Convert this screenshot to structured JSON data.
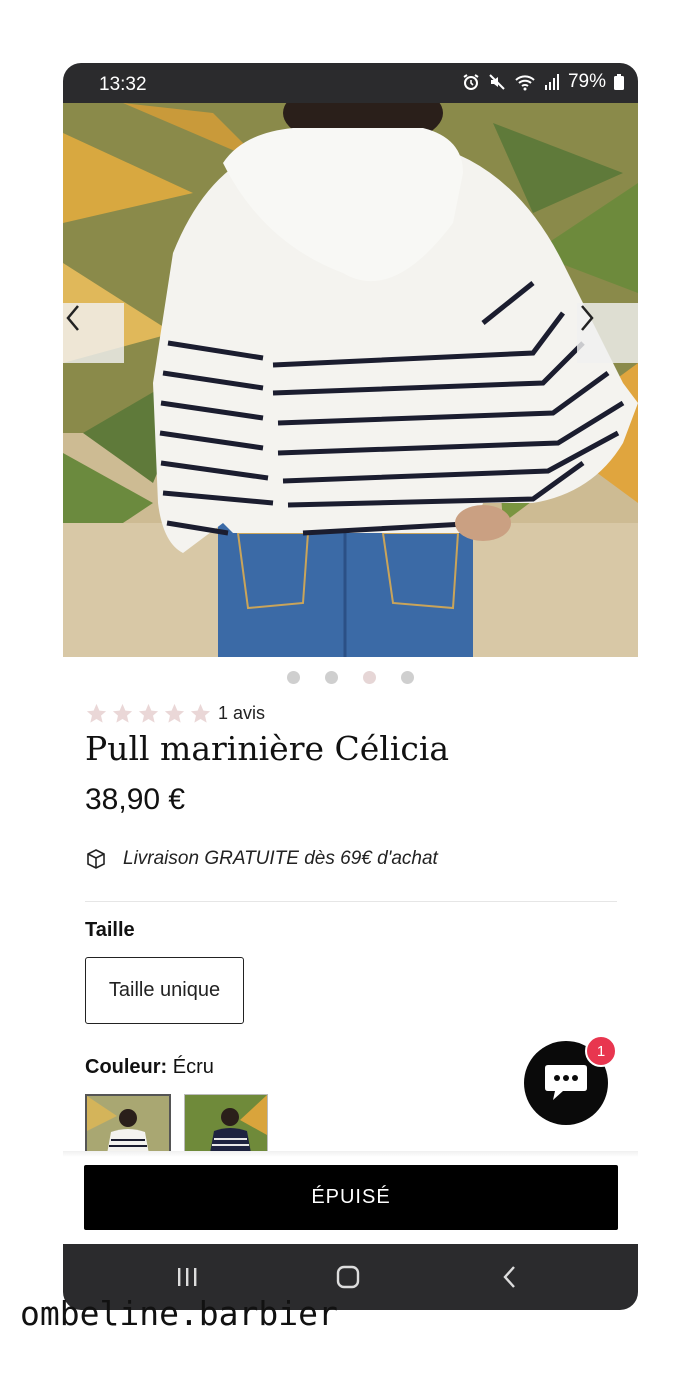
{
  "status_bar": {
    "time": "13:32",
    "battery": "79%",
    "icons": [
      "alarm-icon",
      "mute-icon",
      "wifi-icon",
      "signal-icon",
      "battery-icon"
    ]
  },
  "gallery": {
    "image_description_icon": "product-photo",
    "prev_icon": "chevron-left-icon",
    "next_icon": "chevron-right-icon",
    "dots_total": 4,
    "active_dot": 2
  },
  "rating": {
    "stars": 5,
    "review_text": "1 avis"
  },
  "product": {
    "title": "Pull marinière Célicia",
    "price": "38,90 €"
  },
  "shipping": {
    "icon": "box-icon",
    "text": "Livraison GRATUITE dès 69€ d'achat"
  },
  "size": {
    "label": "Taille",
    "option": "Taille unique"
  },
  "color": {
    "label": "Couleur:",
    "value": "Écru"
  },
  "chat": {
    "icon": "chat-icon",
    "badge": "1"
  },
  "cta": {
    "label": "ÉPUISÉ"
  },
  "nav": {
    "recents_icon": "recents-icon",
    "home_icon": "home-icon",
    "back_icon": "back-icon"
  },
  "watermark": "ombeline.barbier",
  "colors": {
    "status_bar": "#2b2b2d",
    "cta_bg": "#000000",
    "chat_badge": "#e8364f",
    "star": "#ead7d7"
  }
}
